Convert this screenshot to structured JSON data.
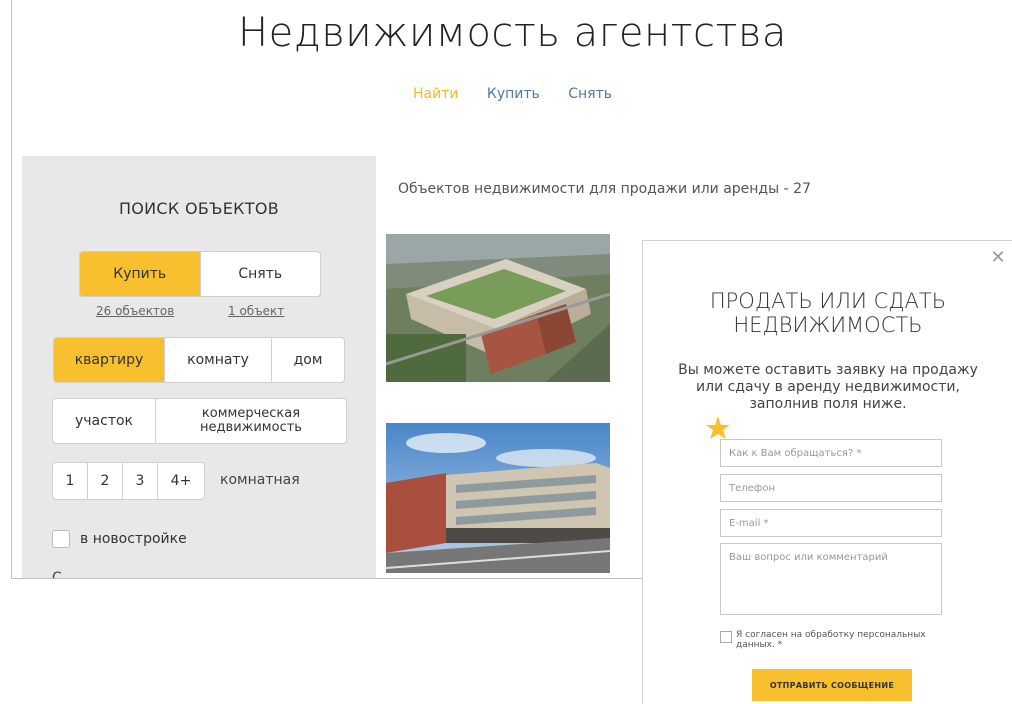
{
  "header": {
    "title": "Недвижимость агентства",
    "nav": [
      {
        "label": "Найти",
        "active": true
      },
      {
        "label": "Купить",
        "active": false
      },
      {
        "label": "Снять",
        "active": false
      }
    ]
  },
  "search": {
    "title": "ПОИСК ОБЪЕКТОВ",
    "deal": {
      "buy": "Купить",
      "rent": "Снять",
      "selected": "buy"
    },
    "counts": {
      "buy": "26 объектов",
      "rent": "1 объект"
    },
    "types_row1": [
      "квартиру",
      "комнату",
      "дом"
    ],
    "types_row2": {
      "plot": "участок",
      "commercial": "коммерческая недвижимость"
    },
    "rooms": [
      "1",
      "2",
      "3",
      "4+"
    ],
    "rooms_label": "комнатная",
    "new_building": "в новостройке",
    "cut_letter": "С"
  },
  "listing": {
    "results": "Объектов недвижимости для продажи или аренды - 27"
  },
  "modal": {
    "title": "ПРОДАТЬ ИЛИ СДАТЬ НЕДВИЖИМОСТЬ",
    "description": "Вы можете оставить заявку на продажу или сдачу в аренду недвижимости, заполнив поля ниже.",
    "fields": {
      "name": "Как к Вам обращаться? *",
      "phone": "Телефон",
      "email": "E-mail *",
      "comment": "Ваш вопрос или комментарий"
    },
    "consent": "Я согласен на обработку персональных данных. *",
    "submit": "ОТПРАВИТЬ СООБЩЕНИЕ"
  },
  "colors": {
    "accent": "#f8bf2e",
    "nav_link": "#4e7aa6",
    "nav_active": "#f5b92b",
    "sidebar_bg": "#e8e8e8"
  }
}
